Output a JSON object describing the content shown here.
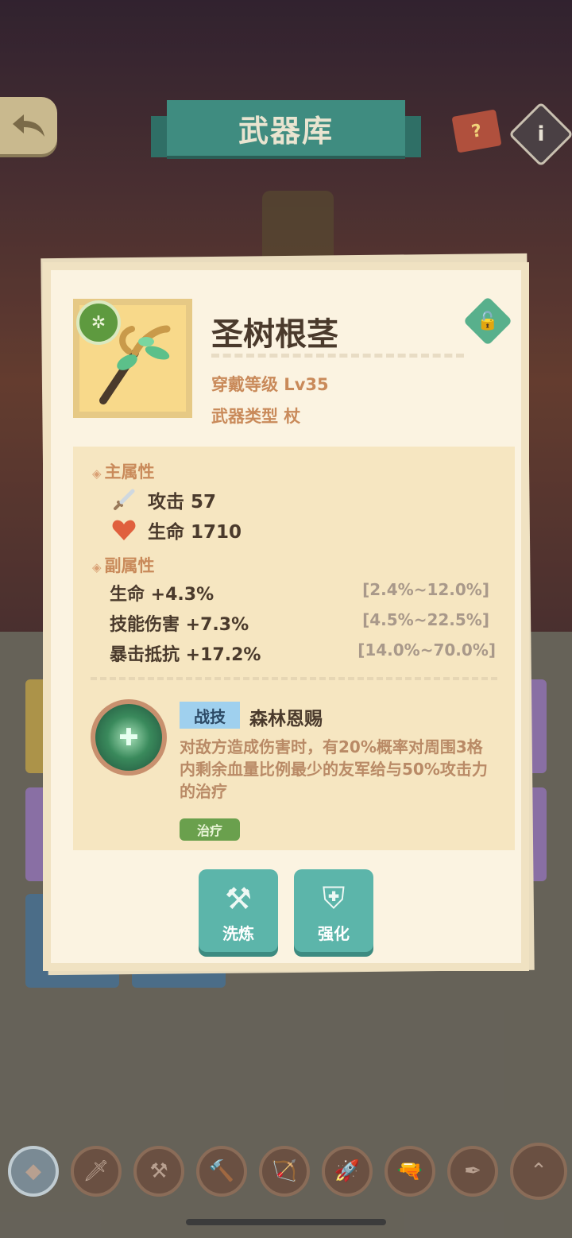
{
  "header": {
    "title": "武器库",
    "back_icon": "back-arrow-icon",
    "book_glyph": "?",
    "info_glyph": "i"
  },
  "weapon": {
    "name": "圣树根茎",
    "level_text": "穿戴等级 Lv35",
    "type_text": "武器类型 杖",
    "element_glyph": "✲",
    "lock_glyph": "🔓"
  },
  "main_attributes": {
    "title": "主属性",
    "items": [
      {
        "icon": "sword-icon",
        "glyph": "🗡",
        "text": "攻击 57"
      },
      {
        "icon": "heart-icon",
        "glyph": "❤",
        "text": "生命 1710"
      }
    ]
  },
  "sub_attributes": {
    "title": "副属性",
    "items": [
      {
        "text": "生命 +4.3%",
        "range": "[2.4%~12.0%]"
      },
      {
        "text": "技能伤害 +7.3%",
        "range": "[4.5%~22.5%]"
      },
      {
        "text": "暴击抵抗 +17.2%",
        "range": "[14.0%~70.0%]"
      }
    ]
  },
  "skill": {
    "tag": "战技",
    "name": "森林恩赐",
    "description": "对敌方造成伤害时，有20%概率对周围3格内剩余血量比例最少的友军给与50%攻击力的治疗",
    "chip": "治疗",
    "icon_glyph": "✚"
  },
  "actions": {
    "refine_label": "洗炼",
    "enhance_label": "强化"
  },
  "bottom_tabs": [
    "◆",
    "🗡",
    "⚒",
    "🔨",
    "🏹",
    "🚀",
    "🔫",
    "✒",
    "⌃"
  ]
}
